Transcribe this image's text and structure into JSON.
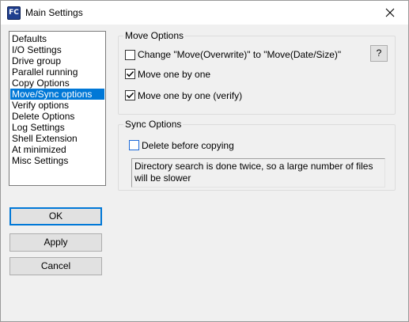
{
  "window": {
    "title": "Main Settings",
    "app_icon_text": "FC"
  },
  "sidebar": {
    "items": [
      {
        "label": "Defaults",
        "selected": false
      },
      {
        "label": "I/O Settings",
        "selected": false
      },
      {
        "label": "Drive group",
        "selected": false
      },
      {
        "label": "Parallel running",
        "selected": false
      },
      {
        "label": "Copy Options",
        "selected": false
      },
      {
        "label": "Move/Sync options",
        "selected": true
      },
      {
        "label": "Verify options",
        "selected": false
      },
      {
        "label": "Delete Options",
        "selected": false
      },
      {
        "label": "Log Settings",
        "selected": false
      },
      {
        "label": "Shell Extension",
        "selected": false
      },
      {
        "label": "At minimized",
        "selected": false
      },
      {
        "label": "Misc Settings",
        "selected": false
      }
    ]
  },
  "buttons": {
    "ok": "OK",
    "apply": "Apply",
    "cancel": "Cancel"
  },
  "move_options": {
    "title": "Move Options",
    "change_move": {
      "label": "Change \"Move(Overwrite)\" to \"Move(Date/Size)\"",
      "checked": false
    },
    "help_label": "?",
    "move_one_by_one": {
      "label": "Move one by one",
      "checked": true
    },
    "move_one_by_one_verify": {
      "label": "Move one by one (verify)",
      "checked": true
    }
  },
  "sync_options": {
    "title": "Sync Options",
    "delete_before_copying": {
      "label": "Delete before copying",
      "checked": false
    },
    "info_text": "Directory search is done twice, so a large number of files will be slower"
  },
  "colors": {
    "selection": "#0078d7",
    "default_button_border": "#0078d7"
  }
}
